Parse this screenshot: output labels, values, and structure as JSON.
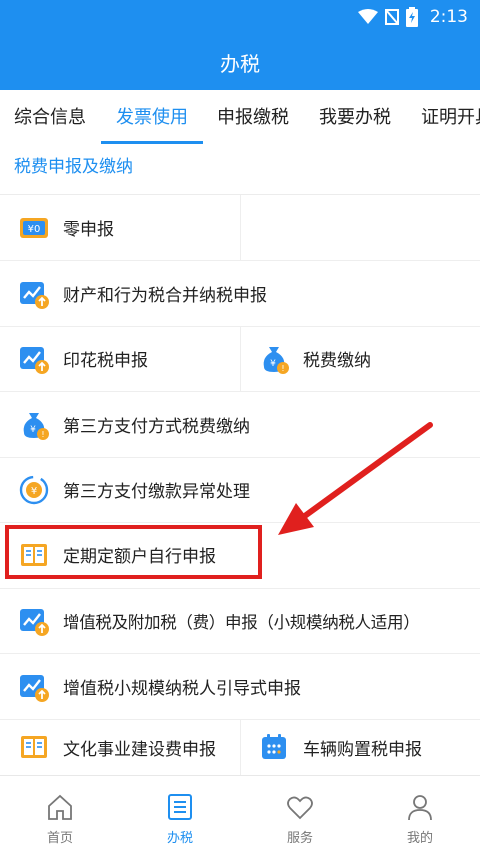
{
  "status_bar": {
    "time": "2:13"
  },
  "header": {
    "title": "办税"
  },
  "tabs": [
    {
      "label": "综合信息"
    },
    {
      "label": "发票使用"
    },
    {
      "label": "申报缴税"
    },
    {
      "label": "我要办税"
    },
    {
      "label": "证明开具"
    }
  ],
  "section": {
    "title": "税费申报及缴纳"
  },
  "items": [
    {
      "label": "零申报",
      "icon": "zero-declare-icon"
    },
    {
      "label": "财产和行为税合并纳税申报",
      "icon": "trend-chart-icon"
    },
    {
      "label": "印花税申报",
      "icon": "trend-chart-icon"
    },
    {
      "label": "税费缴纳",
      "icon": "money-bag-icon"
    },
    {
      "label": "第三方支付方式税费缴纳",
      "icon": "money-bag-icon"
    },
    {
      "label": "第三方支付缴款异常处理",
      "icon": "refresh-coin-icon"
    },
    {
      "label": "定期定额户自行申报",
      "icon": "book-icon"
    },
    {
      "label": "增值税及附加税（费）申报（小规模纳税人适用）",
      "icon": "trend-chart-icon"
    },
    {
      "label": "增值税小规模纳税人引导式申报",
      "icon": "trend-chart-icon"
    },
    {
      "label": "文化事业建设费申报",
      "icon": "book-icon"
    },
    {
      "label": "车辆购置税申报",
      "icon": "calendar-icon"
    }
  ],
  "bottom_nav": [
    {
      "label": "首页",
      "icon": "home-icon"
    },
    {
      "label": "办税",
      "icon": "list-icon"
    },
    {
      "label": "服务",
      "icon": "heart-icon"
    },
    {
      "label": "我的",
      "icon": "user-icon"
    }
  ],
  "colors": {
    "primary": "#1e8ff0",
    "highlight": "#e0201e",
    "icon_orange": "#f5a623"
  }
}
